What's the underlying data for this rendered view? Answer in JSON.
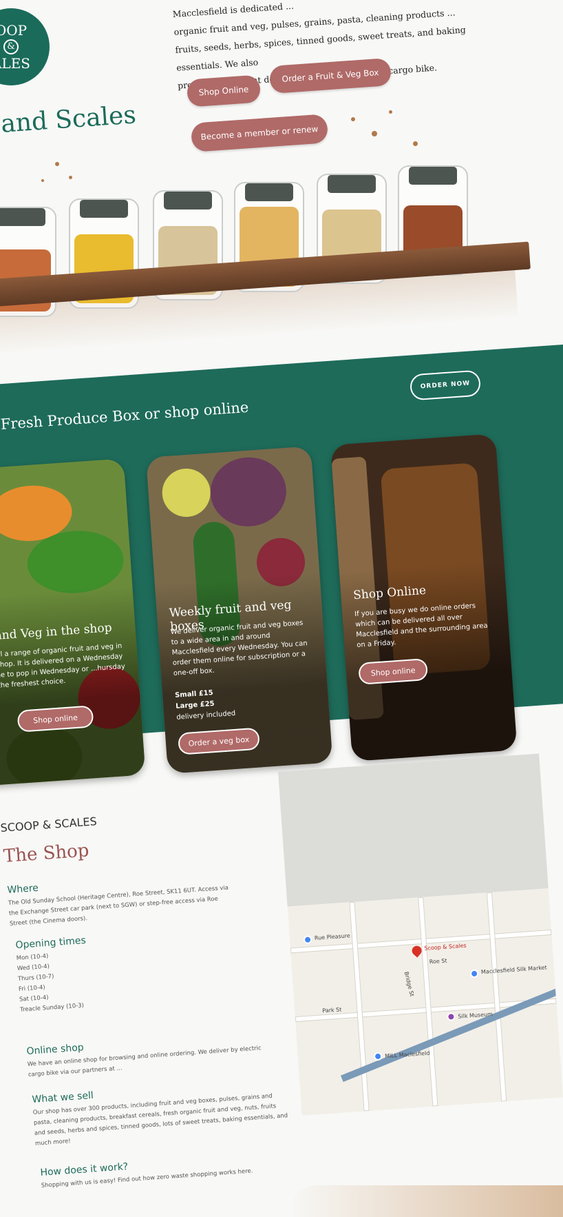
{
  "header": {
    "logo_top": "OOP",
    "logo_amp": "&",
    "logo_bottom": "ALES",
    "brand": "and Scales",
    "intro_lines": [
      "Macclesfield is dedicated ...",
      "organic fruit and veg, pulses, grains, pasta, cleaning products ...",
      "fruits, seeds, herbs, spices, tinned goods, sweet treats, and baking essentials. We also",
      "provide convenient delivery services by electric cargo bike."
    ]
  },
  "buttons": {
    "shop_online": "Shop Online",
    "order_box": "Order a Fruit & Veg Box",
    "member": "Become a member or renew"
  },
  "produce": {
    "title": "Fresh Produce Box or shop online",
    "order_now": "ORDER NOW",
    "cards": [
      {
        "title": "it and Veg in the shop",
        "text": "...sell a range of organic fruit and veg in ...r shop. It is delivered on a Wednesday ...ime to pop in Wednesday or ...hursday for the freshest choice.",
        "button": "Shop online"
      },
      {
        "title": "Weekly fruit and veg boxes",
        "text": "We deliver organic fruit and veg boxes to a wide area in and around Macclesfield every Wednesday. You can order them online for subscription or a one-off box.",
        "price_small": "Small £15",
        "price_large": "Large £25",
        "delivery": "delivery included",
        "button": "Order a veg box"
      },
      {
        "title": "Shop Online",
        "text": "If you are busy we do online orders which can be delivered all over Macclesfield and the surrounding area on a Friday.",
        "button": "Shop online"
      }
    ]
  },
  "shop": {
    "kicker": "SCOOP & SCALES",
    "title": "The Shop",
    "where_h": "Where",
    "where_text": "The Old Sunday School (Heritage Centre), Roe Street, SK11 6UT. Access via the Exchange Street car park (next to SGW) or step-free access via Roe Street (the Cinema doors).",
    "hours_h": "Opening times",
    "hours": [
      "Mon (10-4)",
      "Wed (10-4)",
      "Thurs (10-7)",
      "Fri (10-4)",
      "Sat (10-4)",
      "Treacle Sunday (10-3)"
    ],
    "online_h": "Online shop",
    "online_text": "We have an online shop for browsing and online ordering. We deliver by electric cargo bike via our partners at ...",
    "sell_h": "What we sell",
    "sell_text": "Our shop has over 300 products, including fruit and veg boxes, pulses, grains and pasta, cleaning products, breakfast cereals, fresh organic fruit and veg, nuts, fruits and seeds, herbs and spices, tinned goods, lots of sweet treats, baking essentials, and much more!",
    "how_h": "How does it work?",
    "how_text": "Shopping with us is easy! Find out how zero waste shopping works here."
  },
  "map": {
    "place": "Scoop & Scales",
    "labels": [
      "Rue Pleasure",
      "Macclesfield Silk Market",
      "Silk Museum",
      "MILL Maclesfield",
      "Bridge St",
      "Roe St",
      "Park St"
    ]
  },
  "colors": {
    "brand_green": "#1e6b5a",
    "button_rose": "#b06a68",
    "title_rose": "#9a5452"
  }
}
